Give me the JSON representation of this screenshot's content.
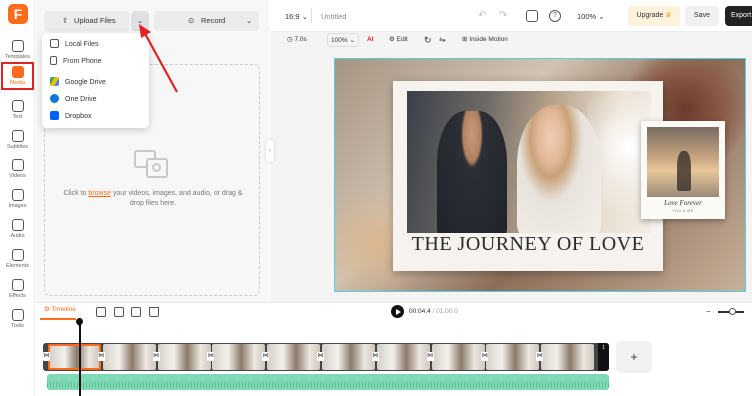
{
  "app": {
    "logo_letter": "F",
    "accent_color": "#ff6b1a",
    "highlight_color": "#e02424"
  },
  "sidebar": {
    "items": [
      {
        "label": "Templates",
        "icon": "templates-icon",
        "active": false
      },
      {
        "label": "Media",
        "icon": "media-folder-icon",
        "active": true
      },
      {
        "label": "Text",
        "icon": "text-icon",
        "active": false
      },
      {
        "label": "Subtitles",
        "icon": "subtitles-icon",
        "active": false
      },
      {
        "label": "Videos",
        "icon": "video-icon",
        "active": false
      },
      {
        "label": "Images",
        "icon": "image-icon",
        "active": false
      },
      {
        "label": "Audio",
        "icon": "music-note-icon",
        "active": false
      },
      {
        "label": "Elements",
        "icon": "elements-icon",
        "active": false
      },
      {
        "label": "Effects",
        "icon": "effects-icon",
        "active": false
      },
      {
        "label": "Tools",
        "icon": "tools-icon",
        "active": false
      }
    ]
  },
  "media_panel": {
    "upload_label": "Upload Files",
    "record_label": "Record",
    "dropdown": {
      "items": [
        {
          "label": "Local Files",
          "icon": "upload-icon"
        },
        {
          "label": "From Phone",
          "icon": "phone-icon"
        },
        {
          "label": "Google Drive",
          "icon": "google-drive-icon"
        },
        {
          "label": "One Drive",
          "icon": "onedrive-icon"
        },
        {
          "label": "Dropbox",
          "icon": "dropbox-icon"
        }
      ]
    },
    "drop_text_before": "Click to ",
    "drop_link": "browse",
    "drop_text_after": " your videos, images, and audio, or drag & drop files here."
  },
  "topbar": {
    "aspect": "16:9",
    "project_name": "Untitled",
    "zoom": "100%",
    "upgrade_label": "Upgrade",
    "save_label": "Save",
    "export_label": "Export"
  },
  "toolbar": {
    "duration": "7.0s",
    "scale": "100%",
    "edit_label": "Edit",
    "inside_motion_label": "Inside Motion"
  },
  "canvas": {
    "title": "THE JOURNEY OF LOVE",
    "polaroid_caption": "Love Forever",
    "polaroid_sub": "YOU & ME"
  },
  "timeline": {
    "label": "Timeline",
    "current_time": "00:04.4",
    "total_time": "01:00.0",
    "clip_count": 10,
    "end_block_label": "1"
  }
}
